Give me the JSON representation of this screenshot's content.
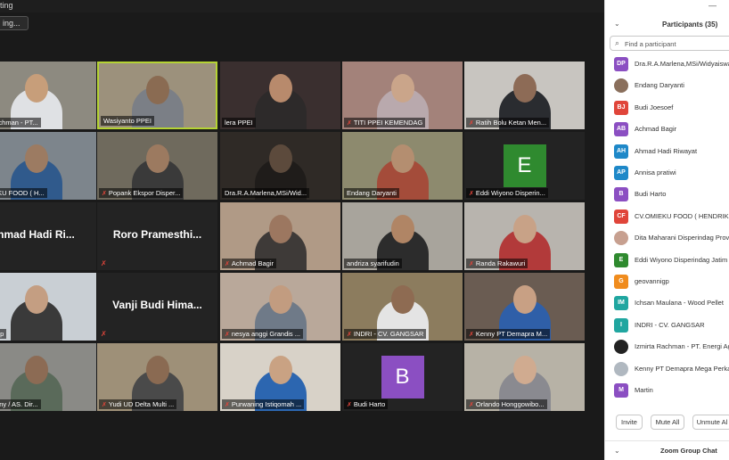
{
  "window": {
    "title_fragment": "ting"
  },
  "view_button": {
    "label": "ing..."
  },
  "tiles": [
    {
      "name": "rta Rachman - PT...",
      "muted": false,
      "bg": "#8d8a80",
      "skin": "#c79e7a",
      "shirt": "#dfe1e4",
      "type": "video"
    },
    {
      "name": "Wasiyanto PPEI",
      "muted": false,
      "bg": "#9c917c",
      "skin": "#8a6b52",
      "shirt": "#7b7f86",
      "type": "video",
      "active": true
    },
    {
      "name": "lera PPEI",
      "muted": false,
      "bg": "#3a2f2f",
      "skin": "#b88a6c",
      "shirt": "#2d2a2a",
      "type": "video"
    },
    {
      "name": "TITI PPEI KEMENDAG",
      "muted": true,
      "bg": "#a3827a",
      "skin": "#caa58a",
      "shirt": "#b9a9ad",
      "type": "video"
    },
    {
      "name": "Ratih Bolu Ketan Men...",
      "muted": true,
      "bg": "#c8c5c0",
      "skin": "#8d6b56",
      "shirt": "#2a2c30",
      "type": "video"
    },
    {
      "name": "OMIEKU FOOD ( H...",
      "muted": false,
      "bg": "#7d858c",
      "skin": "#9c7b62",
      "shirt": "#305a8c",
      "type": "video"
    },
    {
      "name": "Popank Ekspor Disper...",
      "muted": true,
      "bg": "#6f6a5d",
      "skin": "#9c7a60",
      "shirt": "#3a3a3a",
      "type": "video"
    },
    {
      "name": "Dra.R.A.Marlena,MSi/Wid...",
      "muted": false,
      "bg": "#2f2a26",
      "skin": "#5c4a3c",
      "shirt": "#1f1c1a",
      "type": "video"
    },
    {
      "name": "Endang Daryanti",
      "muted": false,
      "bg": "#8d8a6e",
      "skin": "#b48e70",
      "shirt": "#a44c3a",
      "type": "video"
    },
    {
      "name": "Eddi Wiyono Disperin...",
      "muted": true,
      "type": "avatar",
      "letter": "E",
      "color": "#2f8a2f"
    },
    {
      "name": "hmad Hadi Ri...",
      "muted": true,
      "type": "name"
    },
    {
      "name": "Roro Pramesthi...",
      "muted": true,
      "type": "name"
    },
    {
      "name": "Achmad Bagir",
      "muted": true,
      "bg": "#b09a86",
      "skin": "#9c7760",
      "shirt": "#3e3a38",
      "type": "video"
    },
    {
      "name": "andriza syarifudin",
      "muted": false,
      "bg": "#a8a49c",
      "skin": "#b08565",
      "shirt": "#2c2c2c",
      "type": "video"
    },
    {
      "name": "Randa Rakawuri",
      "muted": true,
      "bg": "#b8b4ae",
      "skin": "#c8a287",
      "shirt": "#b23a3a",
      "type": "video"
    },
    {
      "name": "vannigp",
      "muted": false,
      "bg": "#c9cfd4",
      "skin": "#c49e82",
      "shirt": "#3a3a3a",
      "type": "video"
    },
    {
      "name": "Vanji Budi Hima...",
      "muted": true,
      "type": "name"
    },
    {
      "name": "nesya anggi Grandis ...",
      "muted": true,
      "bg": "#b9a89a",
      "skin": "#c29c80",
      "shirt": "#6f7a88",
      "type": "video"
    },
    {
      "name": "INDRI - CV. GANGSAR",
      "muted": true,
      "bg": "#8c7c5e",
      "skin": "#8e6b52",
      "shirt": "#e4e4e4",
      "type": "video"
    },
    {
      "name": "Kenny PT Demapra M...",
      "muted": true,
      "bg": "#6a5c52",
      "skin": "#c8a084",
      "shirt": "#2f5fa8",
      "type": "video"
    },
    {
      "name": "harmony / AS. Dir...",
      "muted": false,
      "bg": "#8a8a86",
      "skin": "#8c6b54",
      "shirt": "#5a6a5a",
      "type": "video"
    },
    {
      "name": "Yudi UD Delta Multi ...",
      "muted": true,
      "bg": "#9e9078",
      "skin": "#8a6a52",
      "shirt": "#4a4a4a",
      "type": "video"
    },
    {
      "name": "Purwaning Istiqomah ...",
      "muted": true,
      "bg": "#d8d2c8",
      "skin": "#c9a283",
      "shirt": "#2c66b0",
      "type": "video"
    },
    {
      "name": "Budi Harto",
      "muted": true,
      "type": "avatar",
      "letter": "B",
      "color": "#8b4fc2"
    },
    {
      "name": "Orlando Honggowibo...",
      "muted": true,
      "bg": "#b7b2a6",
      "skin": "#d0ab90",
      "shirt": "#8a8a90",
      "type": "video"
    }
  ],
  "participants": {
    "title": "Participants (35)",
    "search_placeholder": "Find a participant",
    "list": [
      {
        "initials": "DP",
        "name": "Dra.R.A.Marlena,MSi/Widyaiswa",
        "color": "#8b4fc2",
        "photo": false
      },
      {
        "initials": "",
        "name": "Endang Daryanti",
        "color": "#8a6f5c",
        "photo": true
      },
      {
        "initials": "BJ",
        "name": "Budi Joesoef",
        "color": "#e0453a",
        "photo": false
      },
      {
        "initials": "AB",
        "name": "Achmad Bagir",
        "color": "#8b4fc2",
        "photo": false
      },
      {
        "initials": "AH",
        "name": "Ahmad Hadi Riwayat",
        "color": "#1e88c8",
        "photo": false
      },
      {
        "initials": "AP",
        "name": "Annisa pratiwi",
        "color": "#1e88c8",
        "photo": false
      },
      {
        "initials": "B",
        "name": "Budi Harto",
        "color": "#8b4fc2",
        "photo": false
      },
      {
        "initials": "CF",
        "name": "CV.OMIEKU FOOD ( HENDRIK )",
        "color": "#e0453a",
        "photo": false
      },
      {
        "initials": "",
        "name": "Dita Maharani Disperindag Prov",
        "color": "#c7a090",
        "photo": true
      },
      {
        "initials": "E",
        "name": "Eddi Wiyono Disperindag Jatim",
        "color": "#2f8a2f",
        "photo": false
      },
      {
        "initials": "G",
        "name": "geovannigp",
        "color": "#f08c1e",
        "photo": false
      },
      {
        "initials": "IM",
        "name": "Ichsan Maulana - Wood Pellet",
        "color": "#20a6a0",
        "photo": false
      },
      {
        "initials": "I",
        "name": "INDRI - CV. GANGSAR",
        "color": "#20a6a0",
        "photo": false
      },
      {
        "initials": "",
        "name": "Izmirta Rachman - PT. Energi Ag",
        "color": "#222222",
        "photo": true
      },
      {
        "initials": "",
        "name": "Kenny PT Demapra Mega Perkas",
        "color": "#b0b8c0",
        "photo": true
      },
      {
        "initials": "M",
        "name": "Martin",
        "color": "#8b4fc2",
        "photo": false
      }
    ]
  },
  "buttons": {
    "invite": "Invite",
    "mute_all": "Mute All",
    "unmute_all": "Unmute Al"
  },
  "chat": {
    "title": "Zoom Group Chat"
  },
  "icons": {
    "search": "search-icon",
    "chevron": "chevron-down-icon",
    "mic_muted": "mic-muted-icon"
  }
}
